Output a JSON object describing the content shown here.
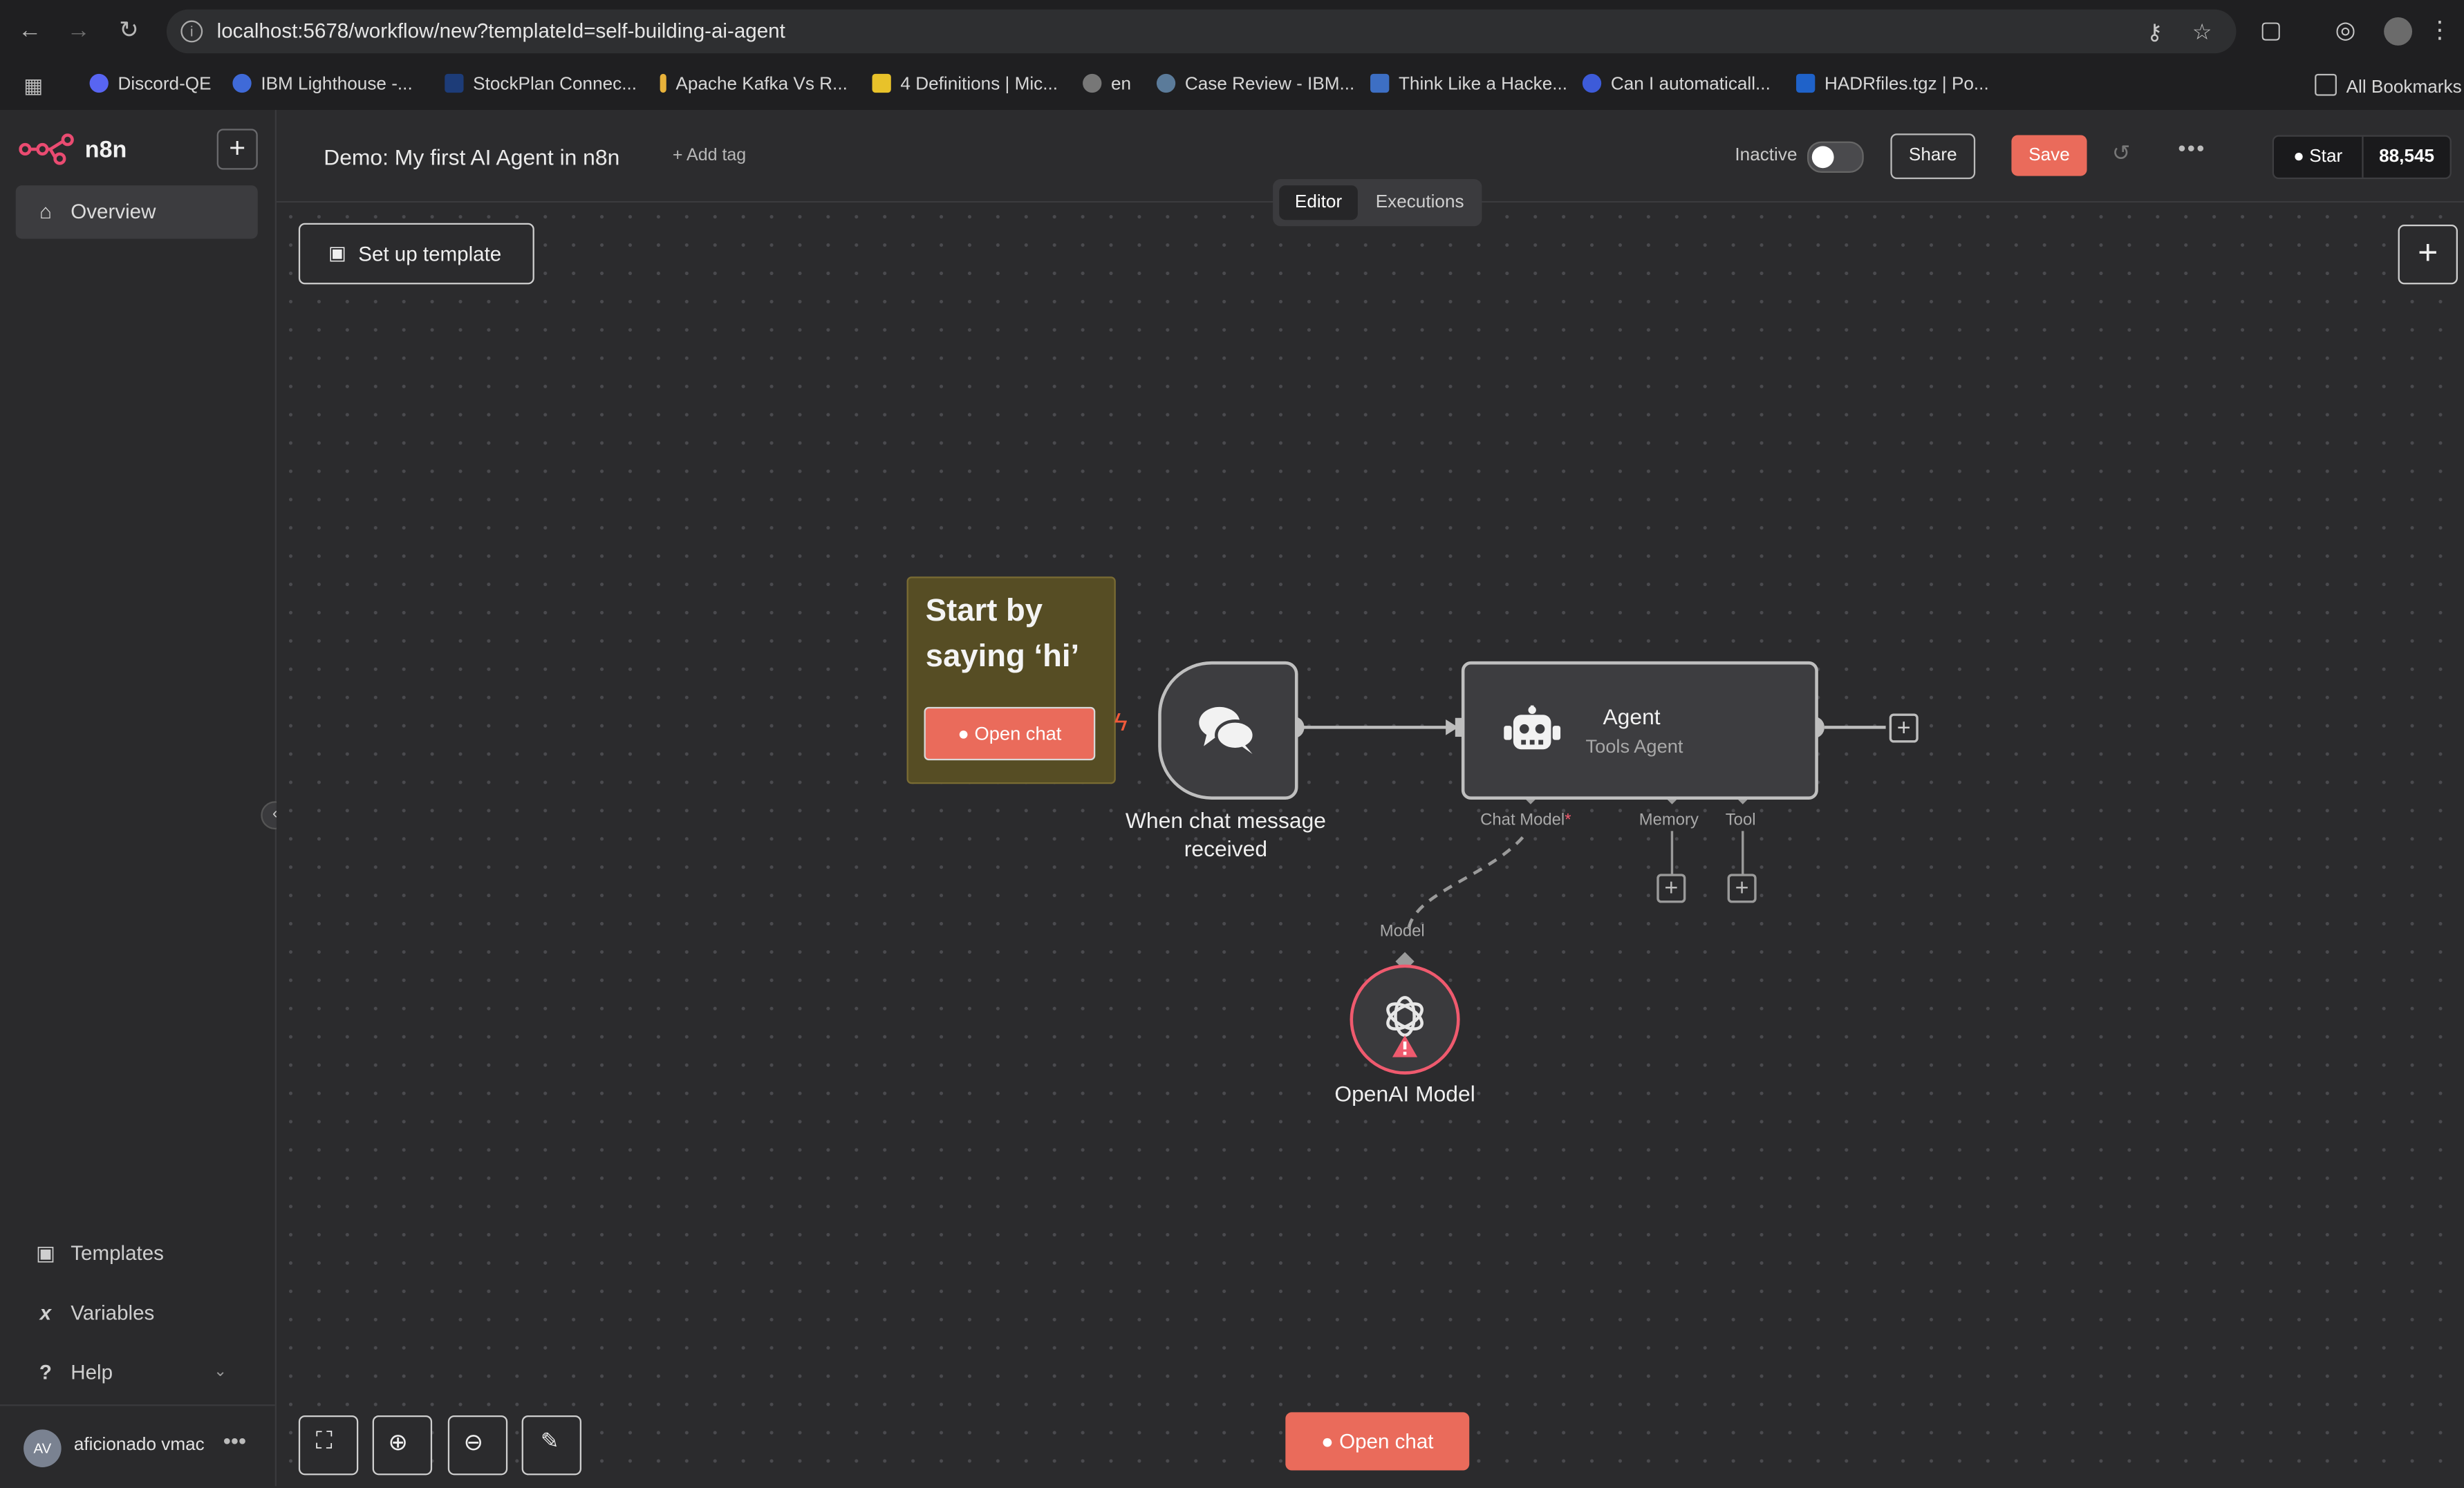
{
  "browser": {
    "url": "localhost:5678/workflow/new?templateId=self-building-ai-agent",
    "bookmarks": [
      "Discord-QE",
      "IBM Lighthouse -...",
      "StockPlan Connec...",
      "Apache Kafka Vs R...",
      "4 Definitions | Mic...",
      "en",
      "Case Review - IBM...",
      "Think Like a Hacke...",
      "Can I automaticall...",
      "HADRfiles.tgz | Po..."
    ],
    "all_bookmarks": "All Bookmarks"
  },
  "sidebar": {
    "brand": "n8n",
    "overview": "Overview",
    "templates": "Templates",
    "variables": "Variables",
    "help": "Help",
    "user_initials": "AV",
    "user_name": "aficionado vmac"
  },
  "header": {
    "title": "Demo: My first AI Agent in n8n",
    "add_tag": "+ Add tag",
    "status": "Inactive",
    "share": "Share",
    "save": "Save",
    "github_star": "Star",
    "github_count": "88,545",
    "tabs": [
      "Editor",
      "Executions"
    ]
  },
  "canvas": {
    "setup_template": "Set up template",
    "sticky_text": "Start by saying ‘hi’",
    "sticky_button": "Open chat",
    "trigger_label": "When chat message received",
    "agent_title": "Agent",
    "agent_subtitle": "Tools Agent",
    "port_chat_model": "Chat Model",
    "port_required": "*",
    "port_memory": "Memory",
    "port_tool": "Tool",
    "model_port_label": "Model",
    "openai_label": "OpenAI Model",
    "open_chat_button": "Open chat"
  },
  "colors": {
    "accent": "#ea6b5b",
    "warning": "#ef5a6e",
    "sticky": "#564d24",
    "canvas": "#2b2b2d"
  },
  "icons": {
    "sidebar_overview": "home-icon",
    "sidebar_templates": "box-icon",
    "sidebar_variables": "variable-icon",
    "sidebar_help": "question-icon",
    "trigger": "chat-bubbles-icon",
    "agent": "robot-icon",
    "openai": "openai-icon"
  }
}
